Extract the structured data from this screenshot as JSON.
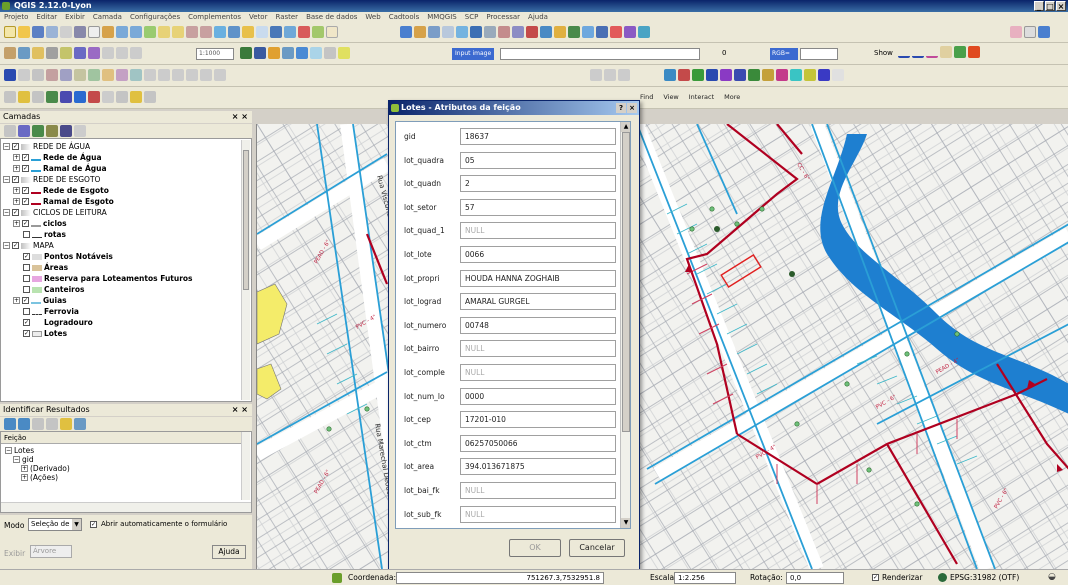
{
  "window": {
    "title": "QGIS 2.12.0-Lyon"
  },
  "menu": [
    "Projeto",
    "Editar",
    "Exibir",
    "Camada",
    "Configurações",
    "Complementos",
    "Vetor",
    "Raster",
    "Base de dados",
    "Web",
    "Cadtools",
    "MMQGIS",
    "SCP",
    "Processar",
    "Ajuda"
  ],
  "toolbar": {
    "input_label": "Input image",
    "bands_label": "RGB=",
    "show_label": "Show",
    "find_label": "Find",
    "view_label": "View",
    "interact_label": "Interact",
    "more_label": "More"
  },
  "layers_panel": {
    "title": "Camadas",
    "items": [
      {
        "label": "REDE DE ÁGUA",
        "checked": true,
        "bold": false
      },
      {
        "label": "Rede de Água",
        "checked": true,
        "bold": true
      },
      {
        "label": "Ramal de Água",
        "checked": true,
        "bold": true
      },
      {
        "label": "REDE DE ESGOTO",
        "checked": true,
        "bold": false
      },
      {
        "label": "Rede de Esgoto",
        "checked": true,
        "bold": true
      },
      {
        "label": "Ramal de Esgoto",
        "checked": true,
        "bold": true
      },
      {
        "label": "CICLOS DE LEITURA",
        "checked": true,
        "bold": false
      },
      {
        "label": "ciclos",
        "checked": true,
        "bold": true
      },
      {
        "label": "rotas",
        "checked": false,
        "bold": true
      },
      {
        "label": "MAPA",
        "checked": true,
        "bold": false
      },
      {
        "label": "Pontos Notáveis",
        "checked": true,
        "bold": true
      },
      {
        "label": "Áreas",
        "checked": false,
        "bold": true
      },
      {
        "label": "Reserva para Loteamentos Futuros",
        "checked": false,
        "bold": true
      },
      {
        "label": "Canteiros",
        "checked": false,
        "bold": true
      },
      {
        "label": "Guias",
        "checked": true,
        "bold": true
      },
      {
        "label": "Ferrovia",
        "checked": false,
        "bold": true
      },
      {
        "label": "Logradouro",
        "checked": true,
        "bold": true
      },
      {
        "label": "Lotes",
        "checked": true,
        "bold": true
      }
    ]
  },
  "identify_panel": {
    "title": "Identificar Resultados",
    "column": "Feição",
    "tree": [
      "Lotes",
      "gid",
      "(Derivado)",
      "(Ações)"
    ],
    "mode_label": "Modo",
    "mode_value": "Seleção de",
    "auto_open_label": "Abrir automaticamente o formulário",
    "view_label": "Exibir",
    "view_value": "Árvore",
    "help_label": "Ajuda"
  },
  "dialog": {
    "title": "Lotes - Atributos da feição",
    "fields": [
      {
        "name": "gid",
        "value": "18637",
        "null": false
      },
      {
        "name": "lot_quadra",
        "value": "05",
        "null": false
      },
      {
        "name": "lot_quadn",
        "value": "2",
        "null": false
      },
      {
        "name": "lot_setor",
        "value": "57",
        "null": false
      },
      {
        "name": "lot_quad_1",
        "value": "NULL",
        "null": true
      },
      {
        "name": "lot_lote",
        "value": "0066",
        "null": false
      },
      {
        "name": "lot_propri",
        "value": "HOUDA HANNA ZOGHAIB",
        "null": false
      },
      {
        "name": "lot_lograd",
        "value": "AMARAL GURGEL",
        "null": false
      },
      {
        "name": "lot_numero",
        "value": "00748",
        "null": false
      },
      {
        "name": "lot_bairro",
        "value": "NULL",
        "null": true
      },
      {
        "name": "lot_comple",
        "value": "NULL",
        "null": true
      },
      {
        "name": "lot_num_lo",
        "value": "0000",
        "null": false
      },
      {
        "name": "lot_cep",
        "value": "17201-010",
        "null": false
      },
      {
        "name": "lot_ctm",
        "value": "06257050066",
        "null": false
      },
      {
        "name": "lot_area",
        "value": "394.013671875",
        "null": false
      },
      {
        "name": "lot_bai_fk",
        "value": "NULL",
        "null": true
      },
      {
        "name": "lot_sub_fk",
        "value": "NULL",
        "null": true
      }
    ],
    "ok_label": "OK",
    "cancel_label": "Cancelar"
  },
  "statusbar": {
    "coord_label": "Coordenada:",
    "coord_value": "751267.3,7532951.8",
    "scale_label": "Escala",
    "scale_value": "1:2.256",
    "rotation_label": "Rotação:",
    "rotation_value": "0,0",
    "render_label": "Renderizar",
    "crs_label": "EPSG:31982 (OTF)"
  },
  "map_labels": {
    "street_1": "Rua Visconde do Rio Branco",
    "street_2": "Rua Marechal Deodoro"
  },
  "colors": {
    "sewer": "#b00020",
    "water": "#2a9fd6",
    "river": "#1e7fd0",
    "parcel": "#8a8f99",
    "lotes_yellow": "#f4ec6a"
  }
}
